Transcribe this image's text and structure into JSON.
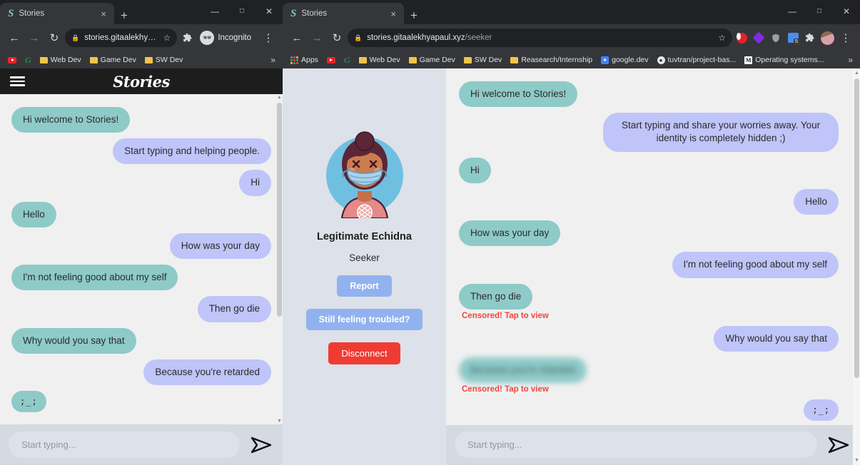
{
  "left_window": {
    "tab": {
      "title": "Stories",
      "favicon": "script-s-icon",
      "close": "×",
      "new_tab": "+"
    },
    "window_controls": {
      "minimize": "—",
      "maximize": "□",
      "close": "✕"
    },
    "toolbar": {
      "back": "←",
      "forward": "→",
      "reload": "↻",
      "lock": "🔒",
      "url": "stories.gitaalekhyapa...",
      "star": "☆",
      "extensions": "🧩",
      "profile_label": "Incognito",
      "menu": "⋮"
    },
    "bookmarks": [
      {
        "label": "",
        "icon": "youtube-icon"
      },
      {
        "label": "",
        "icon": "grammarly-icon"
      },
      {
        "label": "Web Dev",
        "icon": "folder-icon"
      },
      {
        "label": "Game Dev",
        "icon": "folder-icon"
      },
      {
        "label": "SW Dev",
        "icon": "folder-icon"
      }
    ],
    "bookmarks_overflow": "»"
  },
  "right_window": {
    "tab": {
      "title": "Stories",
      "favicon": "script-s-icon",
      "close": "×",
      "new_tab": "+"
    },
    "window_controls": {
      "minimize": "—",
      "maximize": "□",
      "close": "✕"
    },
    "toolbar": {
      "back": "←",
      "forward": "→",
      "reload": "↻",
      "lock": "🔒",
      "url_host": "stories.gitaalekhyapaul.xyz",
      "url_path": "/seeker",
      "star": "☆",
      "menu": "⋮"
    },
    "extensions": [
      "opera-vpn-icon",
      "purple-diamond-icon",
      "shield-icon",
      "blue-app-icon",
      "puzzle-piece-icon",
      "profile-avatar-icon"
    ],
    "extension_badge": "5",
    "bookmarks": [
      {
        "label": "Apps",
        "icon": "apps-grid-icon"
      },
      {
        "label": "",
        "icon": "youtube-icon"
      },
      {
        "label": "",
        "icon": "grammarly-icon"
      },
      {
        "label": "Web Dev",
        "icon": "folder-icon"
      },
      {
        "label": "Game Dev",
        "icon": "folder-icon"
      },
      {
        "label": "SW Dev",
        "icon": "folder-icon"
      },
      {
        "label": "Reasearch/Internship",
        "icon": "folder-icon"
      },
      {
        "label": "google.dev",
        "icon": "google-dev-icon"
      },
      {
        "label": "tuvtran/project-bas...",
        "icon": "github-icon"
      },
      {
        "label": "Operating systems...",
        "icon": "medium-icon"
      }
    ],
    "bookmarks_overflow": "»"
  },
  "app": {
    "brand": "Stories",
    "menu_icon": "hamburger-icon",
    "composer": {
      "placeholder": "Start typing...",
      "send_icon": "send-paper-plane-icon"
    }
  },
  "left_chat": {
    "messages": [
      {
        "side": "them",
        "text": "Hi welcome to Stories!"
      },
      {
        "side": "me",
        "text": "Start typing and helping people."
      },
      {
        "side": "me",
        "text": "Hi"
      },
      {
        "side": "them",
        "text": "Hello"
      },
      {
        "side": "me",
        "text": "How was your day"
      },
      {
        "side": "them",
        "text": "I'm not feeling good about my self"
      },
      {
        "side": "me",
        "text": "Then go die"
      },
      {
        "side": "them",
        "text": "Why would you say that"
      },
      {
        "side": "me",
        "text": "Because you're retarded"
      },
      {
        "side": "them",
        "text": ";_;",
        "emote": true
      }
    ]
  },
  "right_chat": {
    "censored_label": "Censored! Tap to view",
    "messages": [
      {
        "side": "them",
        "text": "Hi welcome to Stories!"
      },
      {
        "side": "me",
        "text": "Start typing and share your worries away. Your identity is completely hidden ;)",
        "wide": true
      },
      {
        "side": "them",
        "text": "Hi"
      },
      {
        "side": "me",
        "text": "Hello"
      },
      {
        "side": "them",
        "text": "How was your day"
      },
      {
        "side": "me",
        "text": "I'm not feeling good about my self"
      },
      {
        "side": "them",
        "text": "Then go die",
        "censored": true
      },
      {
        "side": "me",
        "text": "Why would you say that"
      },
      {
        "side": "them",
        "text": "Because you're retarded",
        "censored": true,
        "blurred": true
      },
      {
        "side": "me",
        "text": ";_;",
        "emote": true
      }
    ]
  },
  "profile": {
    "avatar_name": "masked-character-avatar",
    "name": "Legitimate Echidna",
    "role": "Seeker",
    "buttons": [
      {
        "label": "Report",
        "style": "blue"
      },
      {
        "label": "Still feeling troubled?",
        "style": "blue"
      },
      {
        "label": "Disconnect",
        "style": "red"
      }
    ]
  },
  "colors": {
    "bubble_them": "#8ecac8",
    "bubble_me": "#bfc4f9",
    "accent_blue": "#92b2ef",
    "danger_red": "#ef3b32",
    "censor_red": "#f2453d",
    "profile_bg": "#dde1e9",
    "chat_bg": "#f0f0f0",
    "header_bg": "#1d1d1d"
  }
}
